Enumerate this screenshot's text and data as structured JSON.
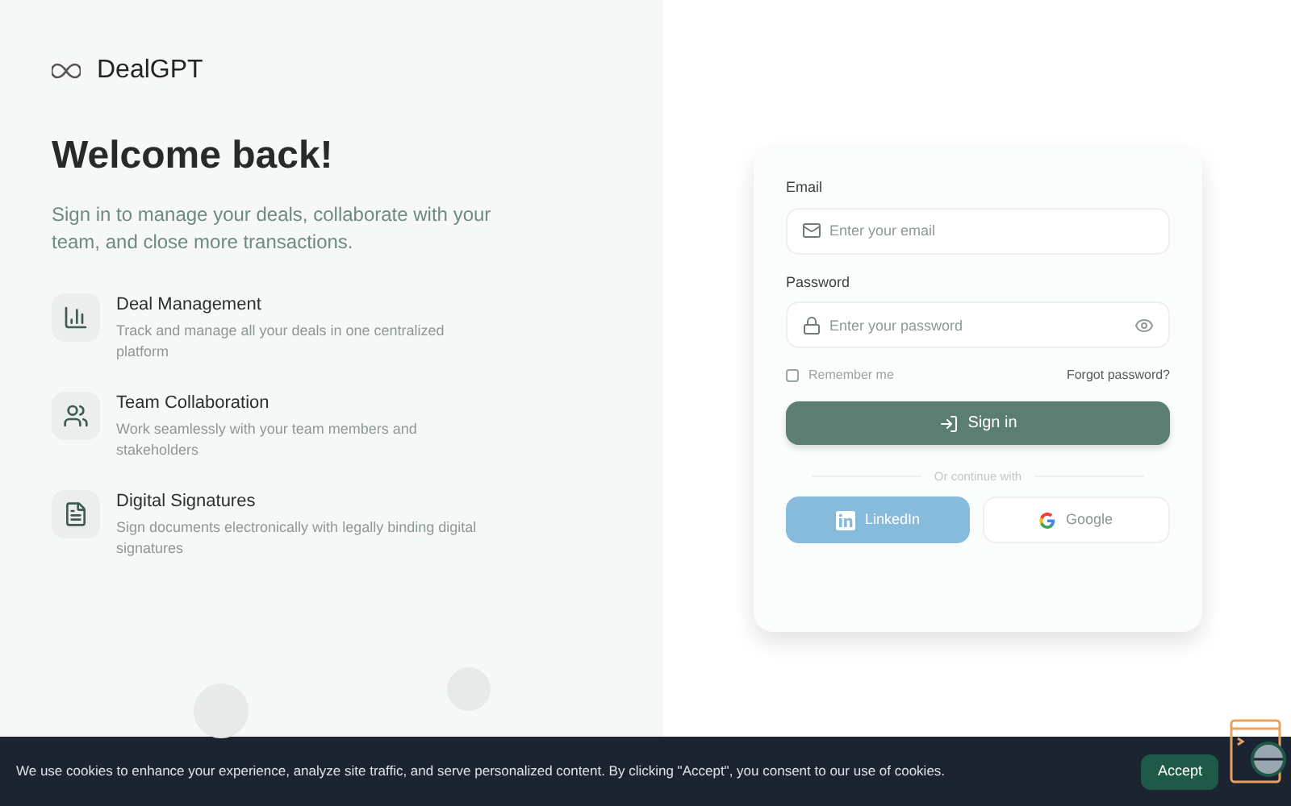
{
  "brand": {
    "name": "DealGPT"
  },
  "hero": {
    "title": "Welcome back!",
    "subtitle": "Sign in to manage your deals, collaborate with your team, and close more transactions."
  },
  "features": [
    {
      "kind": "chart",
      "title": "Deal Management",
      "description": "Track and manage all your deals in one centralized platform"
    },
    {
      "kind": "team",
      "title": "Team Collaboration",
      "description": "Work seamlessly with your team members and stakeholders"
    },
    {
      "kind": "document",
      "title": "Digital Signatures",
      "description": "Sign documents electronically with legally binding digital signatures"
    }
  ],
  "login_form": {
    "email_label": "Email",
    "email_placeholder": "Enter your email",
    "password_label": "Password",
    "password_placeholder": "Enter your password",
    "remember_me": {
      "label": "Remember me",
      "checked": false
    },
    "forgot_password": "Forgot password?",
    "submit": "Sign in",
    "divider": "Or continue with",
    "providers": [
      {
        "kind": "linkedin",
        "label": "LinkedIn"
      },
      {
        "kind": "google",
        "label": "Google"
      }
    ]
  },
  "cookie_banner": {
    "message": "We use cookies to enhance your experience, analyze site traffic, and serve personalized content. By clicking \"Accept\", you consent to our use of cookies.",
    "accept": "Accept"
  }
}
